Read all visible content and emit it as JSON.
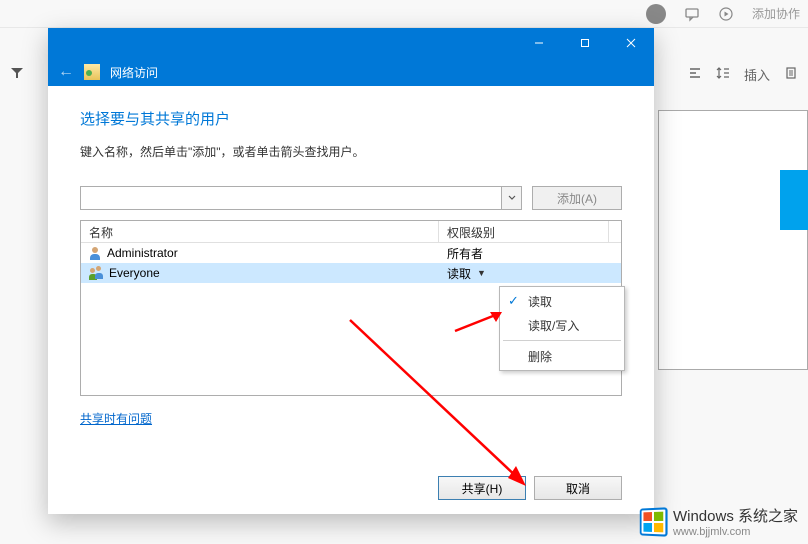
{
  "bg": {
    "add_collab": "添加协作",
    "line_spacing_hint": "‡",
    "insert": "插入",
    "doc_icon": "⎘"
  },
  "dialog": {
    "window_type": "网络访问",
    "heading": "选择要与其共享的用户",
    "subtitle": "键入名称，然后单击\"添加\"，或者单击箭头查找用户。",
    "add_button": "添加(A)",
    "columns": {
      "name": "名称",
      "permission": "权限级别"
    },
    "rows": [
      {
        "name": "Administrator",
        "permission": "所有者",
        "selected": false,
        "icon": "user"
      },
      {
        "name": "Everyone",
        "permission": "读取",
        "selected": true,
        "icon": "group",
        "has_dropdown": true
      }
    ],
    "context_menu": {
      "items": [
        {
          "label": "读取",
          "checked": true
        },
        {
          "label": "读取/写入",
          "checked": false
        }
      ],
      "delete": "删除"
    },
    "help_link": "共享时有问题",
    "buttons": {
      "share": "共享(H)",
      "cancel": "取消"
    }
  },
  "watermark": {
    "brand": "Windows 系统之家",
    "url": "www.bjjmlv.com"
  }
}
